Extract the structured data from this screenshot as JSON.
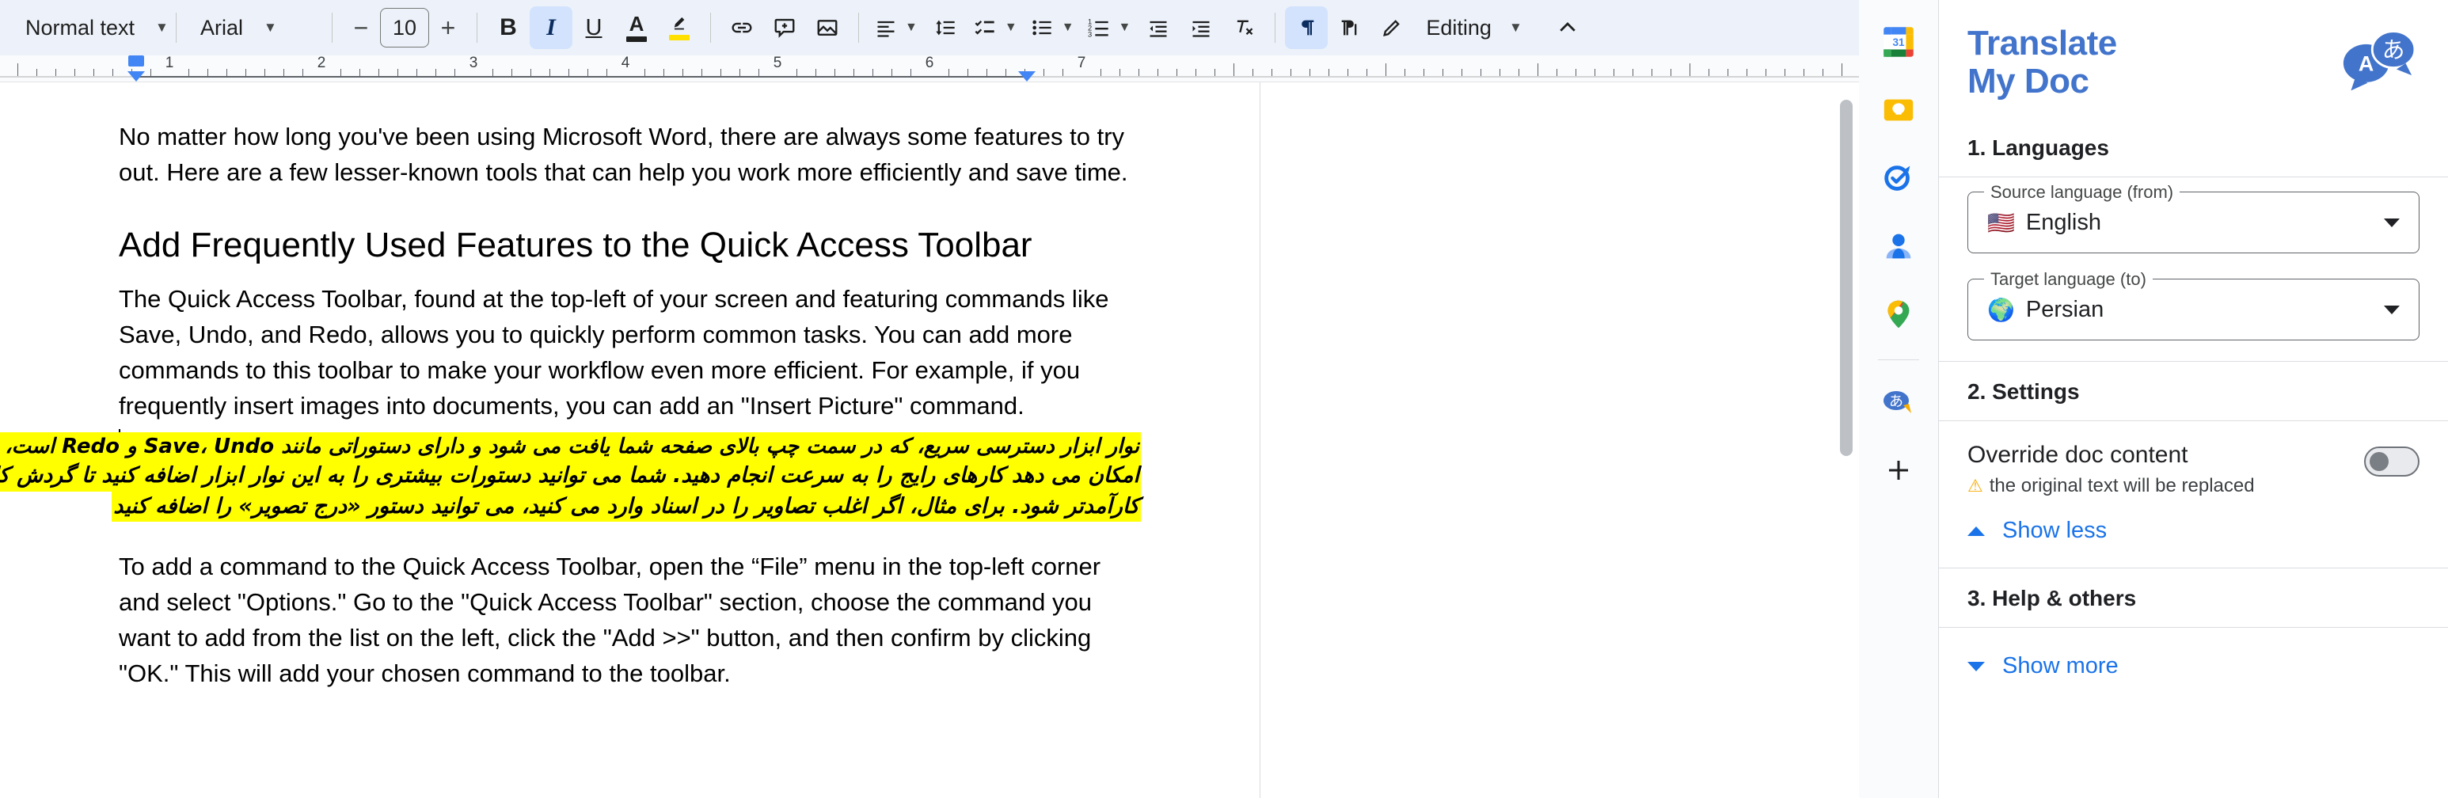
{
  "toolbar": {
    "paragraph_style": "Normal text",
    "font_family": "Arial",
    "font_size": "10",
    "decrease_font": "−",
    "increase_font": "+",
    "bold": "B",
    "italic": "I",
    "underline": "U",
    "text_color": "A",
    "highlight_color": "✎",
    "editing_mode": "Editing",
    "icons": [
      "link-icon",
      "comment-icon",
      "insert-image-icon",
      "align-icon",
      "line-spacing-icon",
      "checklist-icon",
      "bulleted-list-icon",
      "numbered-list-icon",
      "decrease-indent-icon",
      "increase-indent-icon",
      "clear-formatting-icon",
      "paragraph-ltr-icon",
      "paragraph-rtl-icon",
      "pen-icon",
      "collapse-toolbar-icon"
    ]
  },
  "ruler": {
    "numbers": [
      "1",
      "2",
      "3",
      "4",
      "5",
      "6",
      "7"
    ],
    "left_indent_label": "left-indent-marker",
    "right_indent_label": "right-indent-marker"
  },
  "document": {
    "intro": "No matter how long you've been using Microsoft Word, there are always some features to try out. Here are a few lesser-known tools that can help you work more efficiently and save time.",
    "heading": "Add Frequently Used Features to the Quick Access Toolbar",
    "paragraph1": "The Quick Access Toolbar, found at the top-left of your screen and featuring commands like Save, Undo, and Redo, allows you to quickly perform common tasks. You can add more commands to this toolbar to make your workflow even more efficient. For example, if you frequently insert images into documents, you can add an \"Insert Picture\" command.",
    "translated_lines": [
      "نوار ابزار دسترسی سریع، که در سمت چپ بالای صفحه شما یافت می شود و دارای دستوراتی مانند Save، Undo و Redo است، به شما",
      "امکان می دهد کارهای رایج را به سرعت انجام دهید. شما می توانید دستورات بیشتری را به این نوار ابزار اضافه کنید تا گردش کار شما",
      "کارآمدتر شود. برای مثال، اگر اغلب تصاویر را در اسناد وارد می کنید، می توانید دستور «درج تصویر» را اضافه کنید"
    ],
    "paragraph2": "To add a command to the Quick Access Toolbar, open the “File” menu in the top-left corner and select \"Options.\" Go to the \"Quick Access Toolbar\" section, choose the command you want to add from the list on the left, click the \"Add >>\" button, and then confirm by clicking \"OK.\" This will add your chosen command to the toolbar.",
    "highlight_color": "#ffff00"
  },
  "rail": {
    "items": [
      {
        "name": "google-calendar-icon",
        "label": "31"
      },
      {
        "name": "google-keep-icon",
        "label": ""
      },
      {
        "name": "google-tasks-icon",
        "label": ""
      },
      {
        "name": "google-contacts-icon",
        "label": ""
      },
      {
        "name": "google-maps-icon",
        "label": ""
      },
      {
        "name": "translate-my-doc-icon",
        "label": "あ"
      }
    ],
    "add_label": "+"
  },
  "panel": {
    "brand_line1": "Translate",
    "brand_line2": "My Doc",
    "logo_a": "A",
    "logo_jp": "あ",
    "section1_title": "1. Languages",
    "source_label": "Source language (from)",
    "source_value": "English",
    "source_flag": "🇺🇸",
    "target_label": "Target language (to)",
    "target_value": "Persian",
    "target_flag": "🌍",
    "section2_title": "2. Settings",
    "override_label": "Override doc content",
    "override_note": "the original text will be replaced",
    "warn_glyph": "⚠",
    "override_enabled": false,
    "show_less": "Show less",
    "section3_title": "3. Help & others",
    "show_more": "Show more",
    "accent_color": "#1a73e8",
    "brand_color": "#4274cc"
  }
}
